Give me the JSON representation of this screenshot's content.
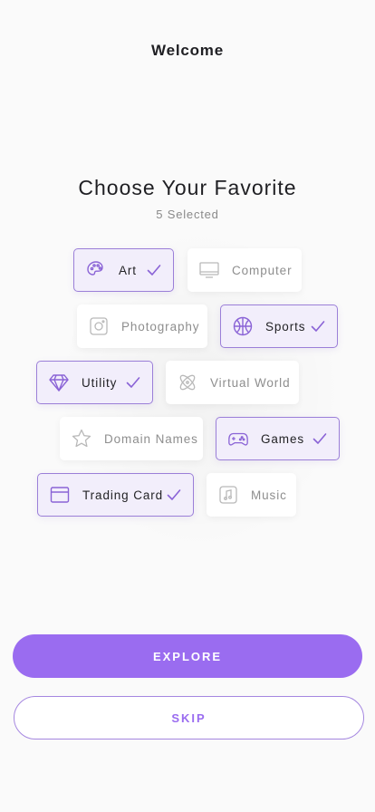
{
  "header": {
    "title": "Welcome"
  },
  "main": {
    "title": "Choose Your Favorite",
    "selected_count": "5 Selected"
  },
  "categories": [
    {
      "label": "Art",
      "selected": true,
      "icon": "palette-icon"
    },
    {
      "label": "Computer",
      "selected": false,
      "icon": "monitor-icon"
    },
    {
      "label": "Photography",
      "selected": false,
      "icon": "camera-icon"
    },
    {
      "label": "Sports",
      "selected": true,
      "icon": "basketball-icon"
    },
    {
      "label": "Utility",
      "selected": true,
      "icon": "diamond-icon"
    },
    {
      "label": "Virtual World",
      "selected": false,
      "icon": "atom-icon"
    },
    {
      "label": "Domain Names",
      "selected": false,
      "icon": "star-icon"
    },
    {
      "label": "Games",
      "selected": true,
      "icon": "gamepad-icon"
    },
    {
      "label": "Trading Card",
      "selected": true,
      "icon": "card-icon"
    },
    {
      "label": "Music",
      "selected": false,
      "icon": "music-note-icon"
    }
  ],
  "actions": {
    "explore_label": "EXPLORE",
    "skip_label": "SKIP"
  },
  "colors": {
    "accent": "#9a6cf0",
    "accent_border": "#9b7fd8",
    "selected_bg": "#f2eefb",
    "background": "#fafafa"
  }
}
